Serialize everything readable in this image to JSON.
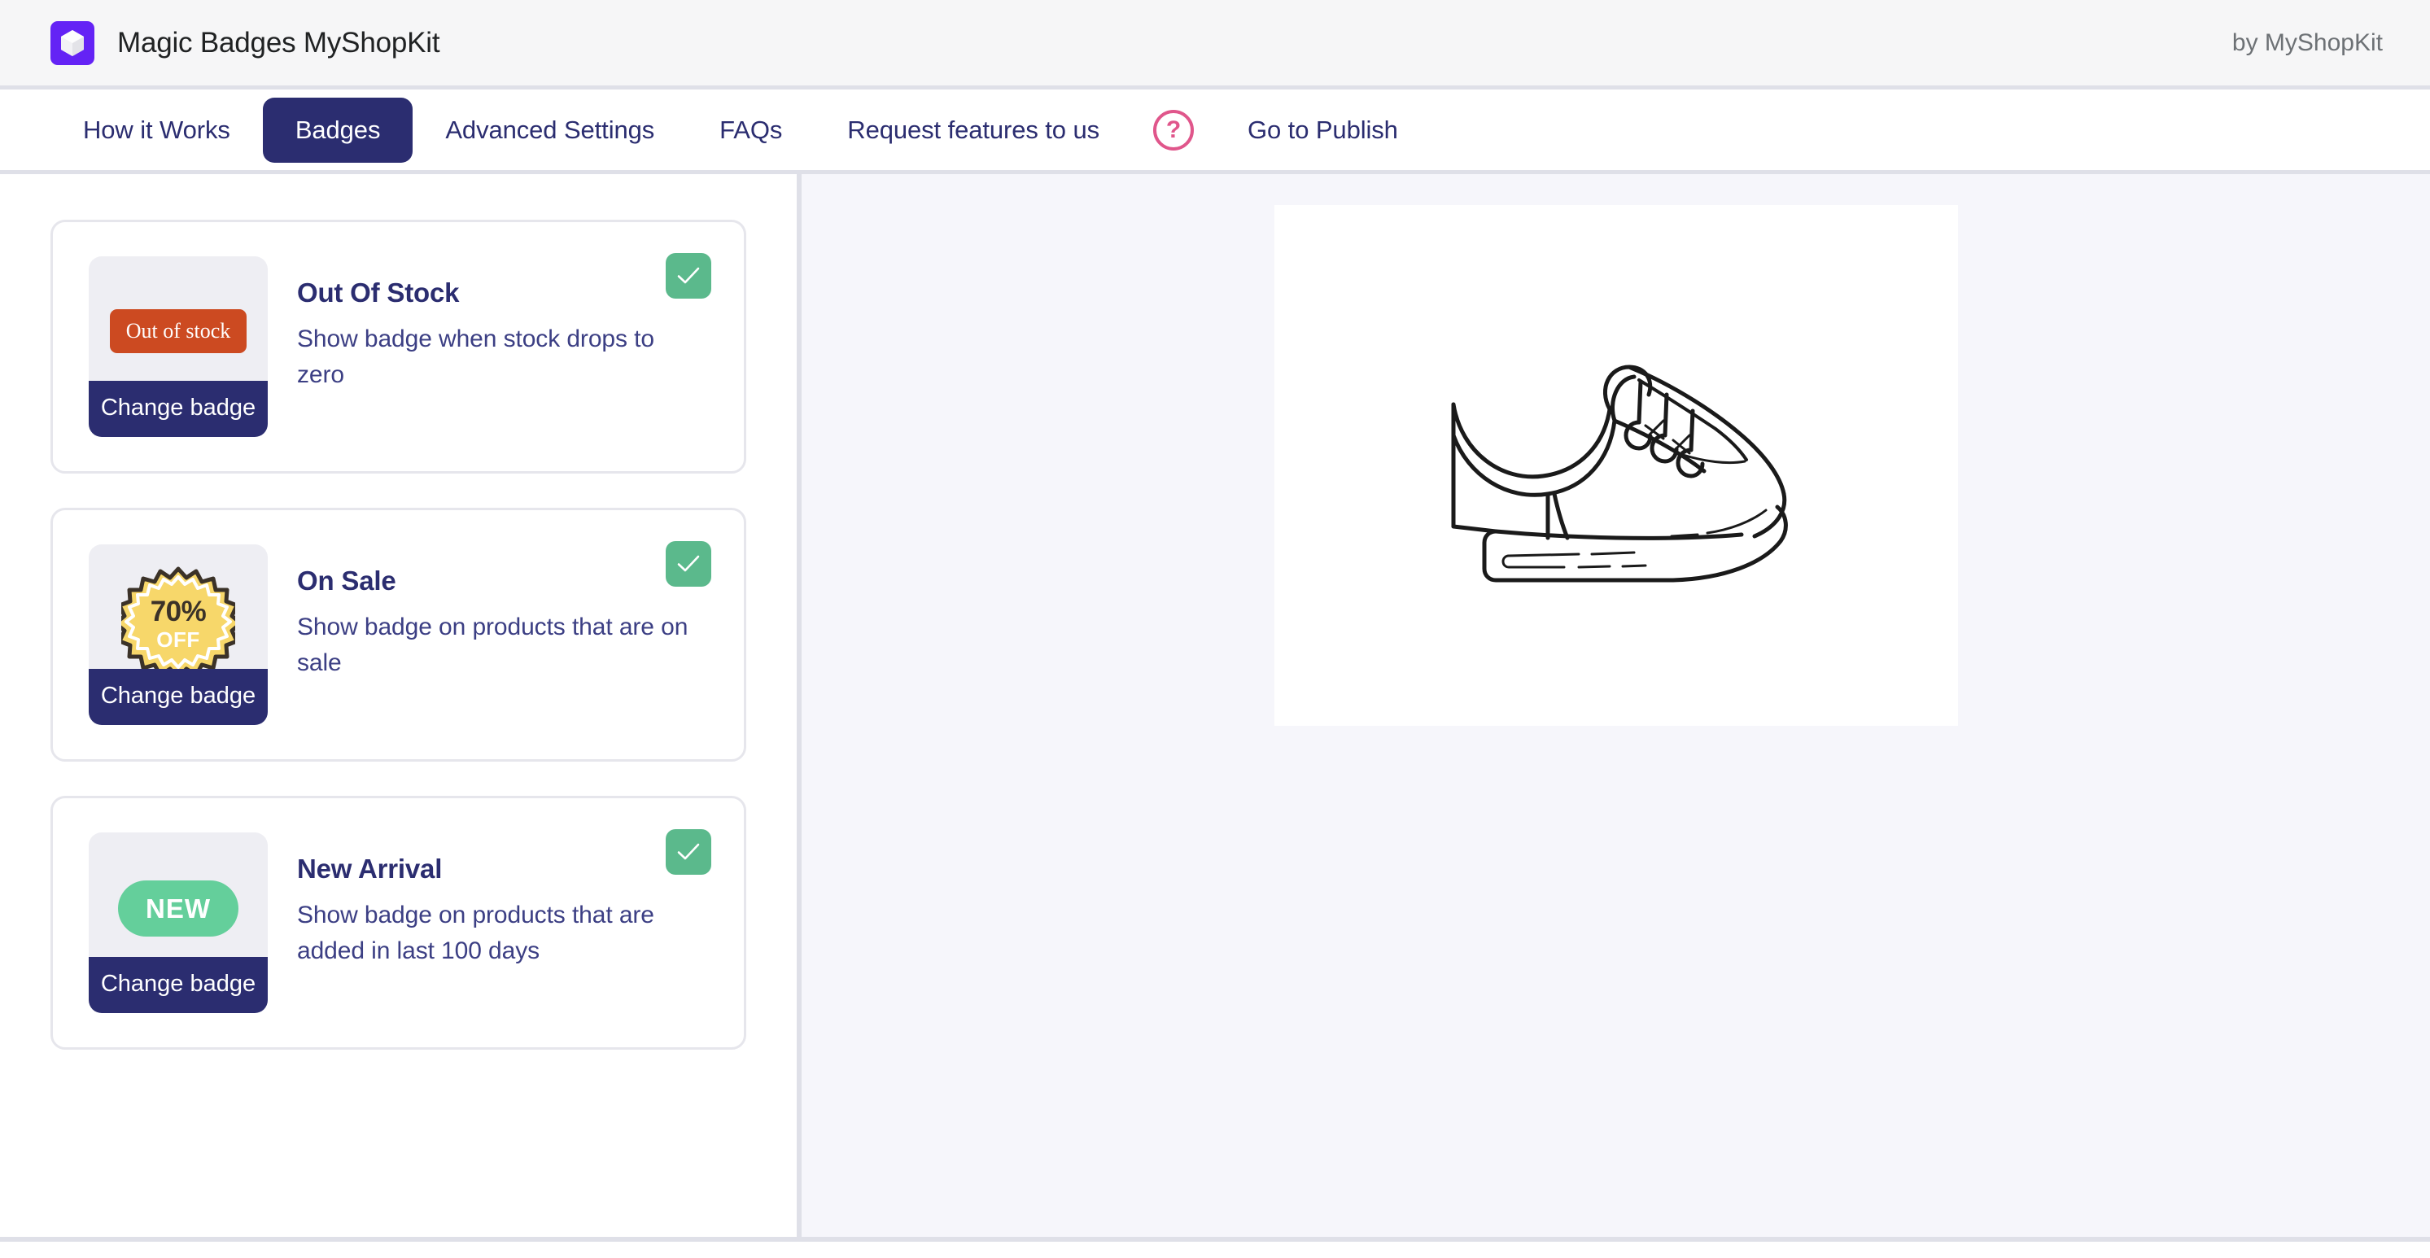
{
  "header": {
    "logo_icon": "cube-logo-icon",
    "logo_bg": "#6423f5",
    "title": "Magic Badges MyShopKit",
    "byline": "by MyShopKit"
  },
  "nav": {
    "items": [
      {
        "label": "How it Works",
        "active": false
      },
      {
        "label": "Badges",
        "active": true
      },
      {
        "label": "Advanced Settings",
        "active": false
      },
      {
        "label": "FAQs",
        "active": false
      },
      {
        "label": "Request features to us",
        "active": false
      },
      {
        "label": "Go to Publish",
        "active": false
      }
    ],
    "help_icon_label": "?",
    "active_color": "#2b2d70",
    "help_color": "#e0568b"
  },
  "badges": {
    "change_badge_label": "Change badge",
    "items": [
      {
        "title": "Out Of Stock",
        "description": "Show badge when stock drops to zero",
        "enabled": true,
        "preview_type": "out-of-stock",
        "preview_text": "Out of stock",
        "preview_color": "#cc4a21"
      },
      {
        "title": "On Sale",
        "description": "Show badge on products that are on sale",
        "enabled": true,
        "preview_type": "on-sale",
        "preview_percent": "70%",
        "preview_off": "OFF",
        "preview_color": "#f7d76a"
      },
      {
        "title": "New Arrival",
        "description": "Show badge on products that are added in last 100 days",
        "enabled": true,
        "preview_type": "new-arrival",
        "preview_text": "NEW",
        "preview_color": "#64cf9b"
      }
    ]
  },
  "preview": {
    "product_image_alt": "sneaker-line-art",
    "canvas_bg": "#ffffff",
    "pane_bg": "#f6f6fb"
  }
}
